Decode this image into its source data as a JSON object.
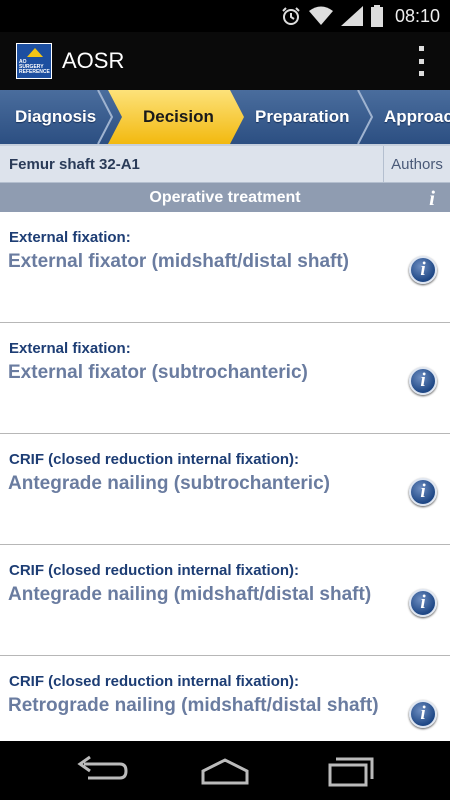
{
  "status": {
    "time": "08:10",
    "icons": [
      "alarm-icon",
      "wifi-icon",
      "signal-icon",
      "battery-icon"
    ]
  },
  "app": {
    "title": "AOSR",
    "logo_text": "AO SURGERY REFERENCE"
  },
  "steps": [
    "Diagnosis",
    "Decision",
    "Preparation",
    "Approach"
  ],
  "case": {
    "title": "Femur shaft 32-A1",
    "authors_label": "Authors"
  },
  "section": {
    "title": "Operative treatment",
    "info": "i"
  },
  "options": [
    {
      "category": "External fixation:",
      "name": "External fixator (midshaft/distal shaft)"
    },
    {
      "category": "External fixation:",
      "name": "External fixator (subtrochanteric)"
    },
    {
      "category": "CRIF (closed reduction internal fixation):",
      "name": "Antegrade nailing (subtrochanteric)"
    },
    {
      "category": "CRIF (closed reduction internal fixation):",
      "name": "Antegrade nailing (midshaft/distal shaft)"
    },
    {
      "category": "CRIF (closed reduction internal fixation):",
      "name": "Retrograde nailing (midshaft/distal shaft)"
    }
  ],
  "info_glyph": "i",
  "colors": {
    "accent": "#f5c518",
    "tabs": "#2c4f82",
    "category": "#1d3d74",
    "option_name": "#6a7ca0"
  }
}
